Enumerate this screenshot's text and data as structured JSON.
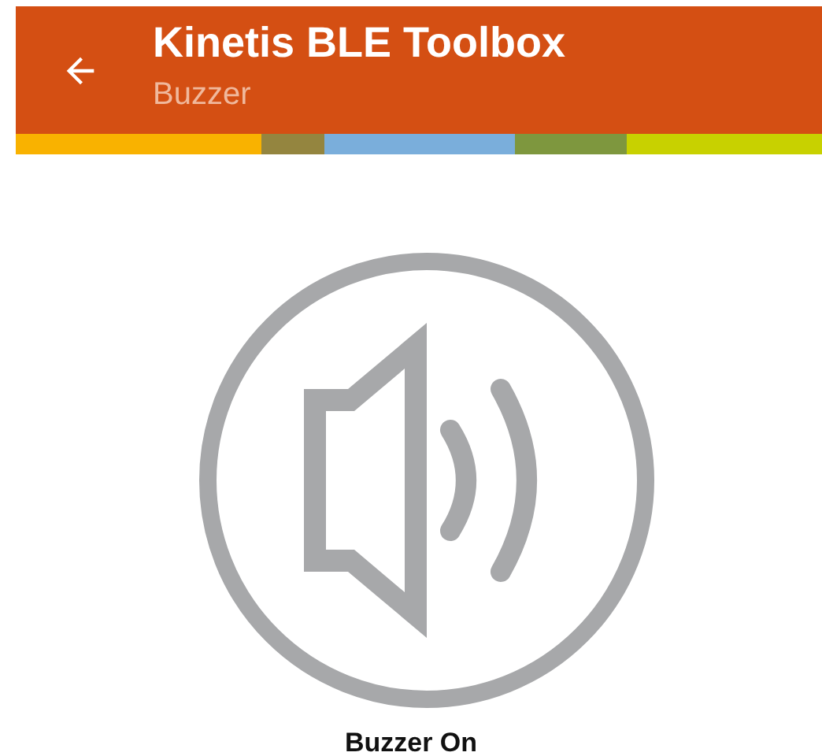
{
  "app_bar": {
    "title": "Kinetis BLE Toolbox",
    "subtitle": "Buzzer"
  },
  "status_label": "Buzzer On"
}
